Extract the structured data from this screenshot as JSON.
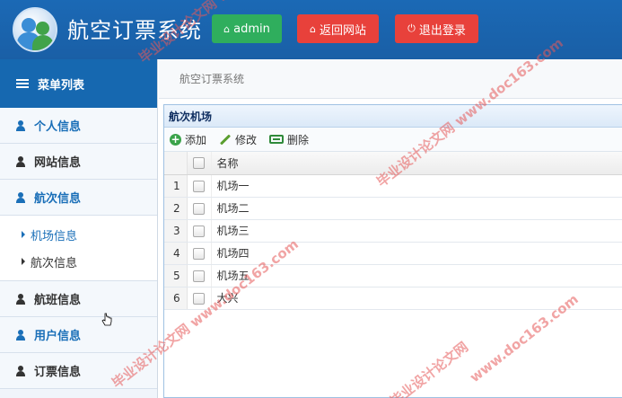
{
  "header": {
    "title": "航空订票系统",
    "admin_label": "admin",
    "back_label": "返回网站",
    "logout_label": "退出登录",
    "colors": {
      "bar": "#1a65b0",
      "admin": "#2fae5d",
      "danger": "#e8413b"
    }
  },
  "sidebar": {
    "heading": "菜单列表",
    "items": [
      {
        "label": "个人信息",
        "icon": "user-icon"
      },
      {
        "label": "网站信息",
        "icon": "user-icon"
      },
      {
        "label": "航次信息",
        "icon": "user-icon"
      },
      {
        "label": "航班信息",
        "icon": "user-icon"
      },
      {
        "label": "用户信息",
        "icon": "user-icon"
      },
      {
        "label": "订票信息",
        "icon": "user-icon"
      }
    ],
    "subitems": [
      {
        "label": "机场信息",
        "active": true
      },
      {
        "label": "航次信息",
        "active": false
      }
    ]
  },
  "breadcrumb": "航空订票系统",
  "panel": {
    "title": "航次机场",
    "toolbar": {
      "add": "添加",
      "edit": "修改",
      "delete": "删除"
    },
    "columns": {
      "name": "名称"
    },
    "rows": [
      {
        "num": "1",
        "name": "机场一"
      },
      {
        "num": "2",
        "name": "机场二"
      },
      {
        "num": "3",
        "name": "机场三"
      },
      {
        "num": "4",
        "name": "机场四"
      },
      {
        "num": "5",
        "name": "机场五"
      },
      {
        "num": "6",
        "name": "大兴"
      }
    ]
  },
  "watermarks": {
    "text1": "毕业设计论文网",
    "text2": "www.doc163.com",
    "text3": "毕业设计论文网 www.doc163.com"
  }
}
